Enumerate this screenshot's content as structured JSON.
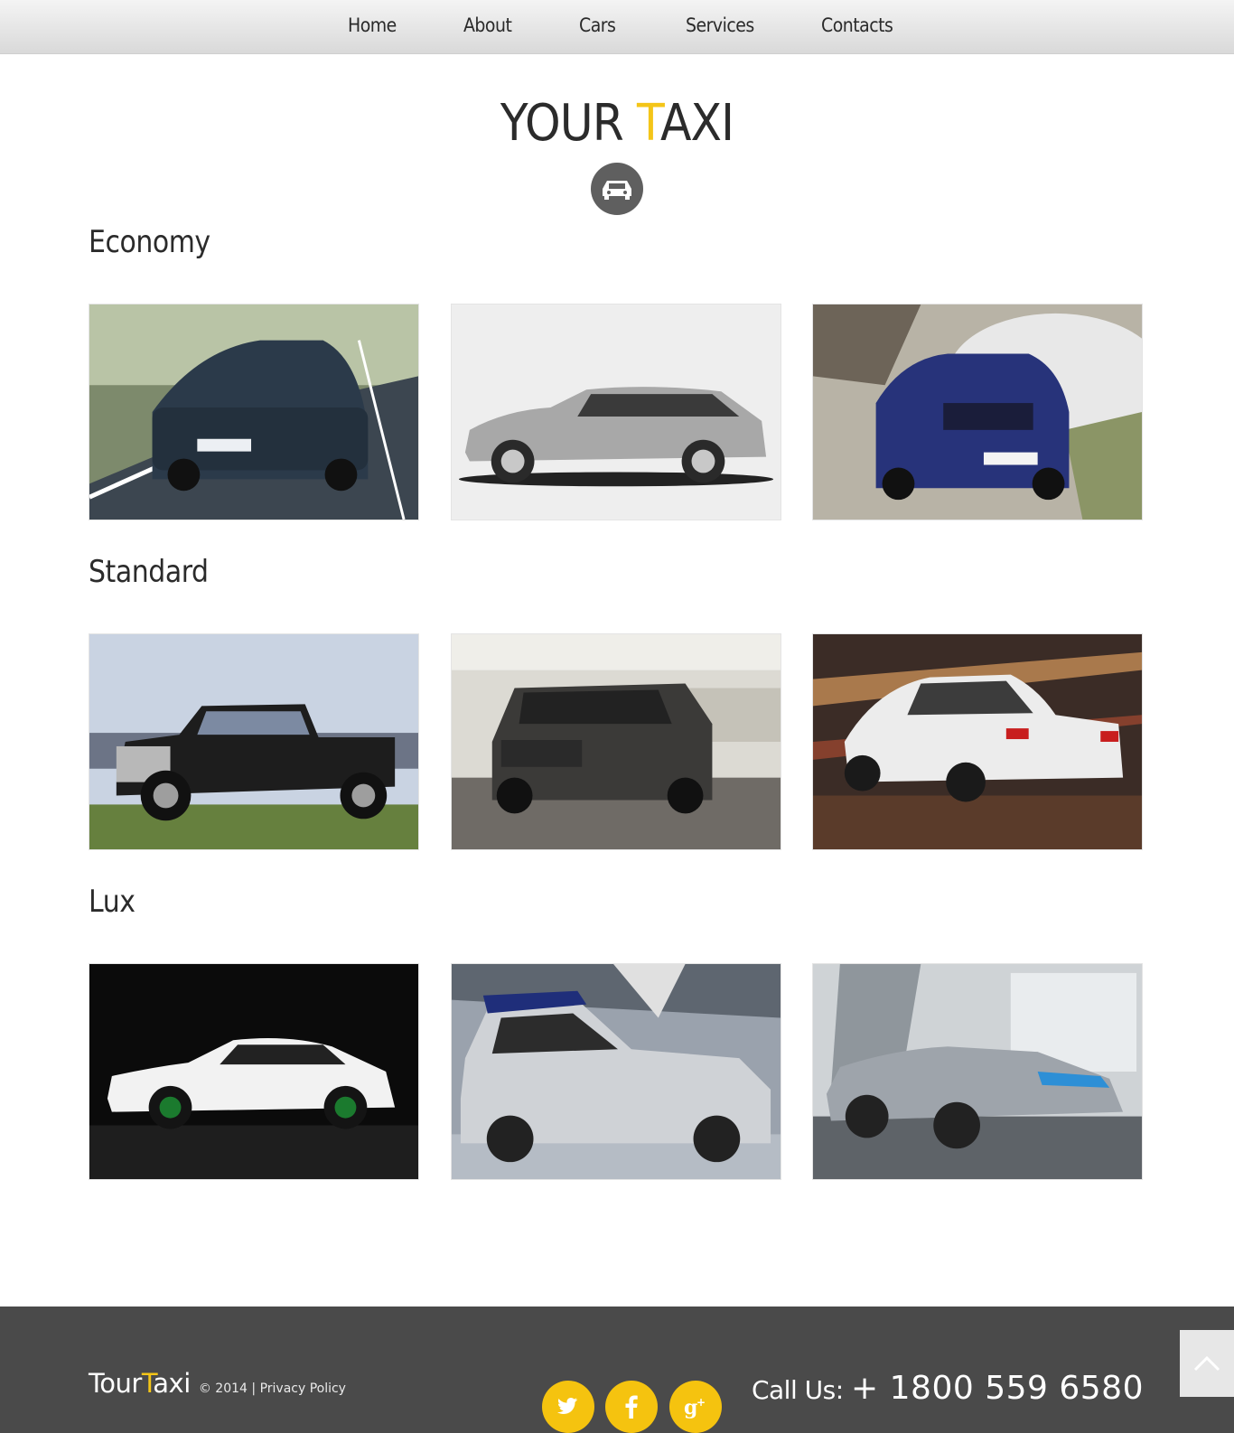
{
  "nav": {
    "items": [
      {
        "label": "Home"
      },
      {
        "label": "About"
      },
      {
        "label": "Cars"
      },
      {
        "label": "Services"
      },
      {
        "label": "Contacts"
      }
    ]
  },
  "logo": {
    "before": "YOUR ",
    "accent": "T",
    "after": "AXI",
    "badge_icon": "car-icon"
  },
  "categories": [
    {
      "title": "Economy",
      "photos": [
        "bmw-sedan-photo",
        "silver-wagon-photo",
        "blue-suv-photo"
      ]
    },
    {
      "title": "Standard",
      "photos": [
        "pickup-truck-photo",
        "land-rover-photo",
        "white-sedan-photo"
      ]
    },
    {
      "title": "Lux",
      "photos": [
        "white-coupe-photo",
        "silver-hatchback-photo",
        "concept-roadster-photo"
      ]
    }
  ],
  "footer": {
    "brand_before": "Tour",
    "brand_accent": "T",
    "brand_after": "axi",
    "copyright": "© 2014 | ",
    "privacy": "Privacy Policy",
    "social": [
      "twitter-icon",
      "facebook-icon",
      "google-plus-icon"
    ],
    "call_label": "Call Us: ",
    "phone": "+ 1800 559 6580"
  },
  "colors": {
    "accent": "#f4c518",
    "footer_bg": "#4a4a4a",
    "social_bg": "#f5c30f"
  }
}
